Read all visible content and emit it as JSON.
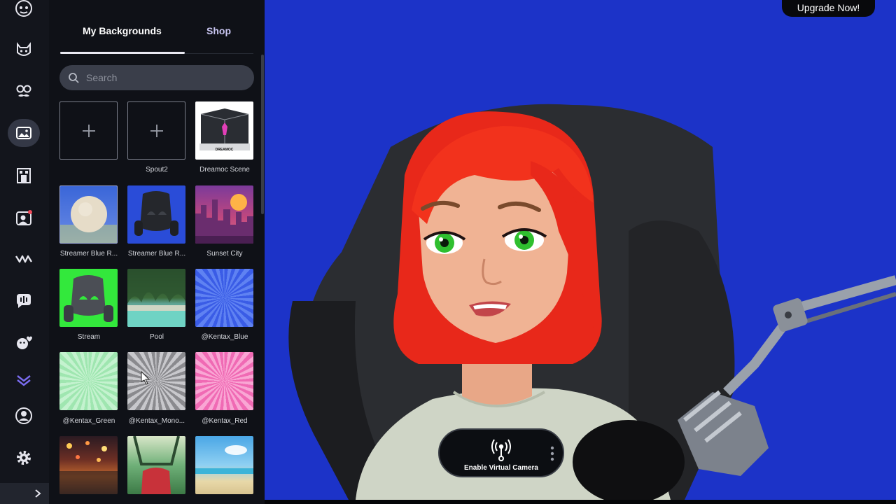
{
  "panel": {
    "tabs": {
      "mine": "My Backgrounds",
      "shop": "Shop"
    },
    "search": {
      "placeholder": "Search"
    },
    "tiles": [
      {
        "label": "",
        "type": "add"
      },
      {
        "label": "Spout2",
        "type": "add"
      },
      {
        "label": "Dreamoc Scene",
        "type": "image",
        "inner_text": "DREAMOC"
      },
      {
        "label": "Streamer Blue R...",
        "type": "image"
      },
      {
        "label": "Streamer Blue R...",
        "type": "image"
      },
      {
        "label": "Sunset City",
        "type": "image"
      },
      {
        "label": "Stream",
        "type": "image"
      },
      {
        "label": "Pool",
        "type": "image"
      },
      {
        "label": "@Kentax_Blue",
        "type": "image"
      },
      {
        "label": "@Kentax_Green",
        "type": "image"
      },
      {
        "label": "@Kentax_Mono...",
        "type": "image"
      },
      {
        "label": "@Kentax_Red",
        "type": "image"
      },
      {
        "label": "",
        "type": "image"
      },
      {
        "label": "",
        "type": "image"
      },
      {
        "label": "",
        "type": "image"
      }
    ]
  },
  "rail": {
    "icons": [
      "logo-icon",
      "cat-mask-icon",
      "glasses-mustache-icon",
      "backgrounds-icon",
      "scene-icon",
      "camera-face-icon",
      "motion-icon",
      "voice-icon",
      "emote-icon",
      "chevron-stack-icon",
      "profile-icon",
      "settings-icon",
      "expand-icon"
    ]
  },
  "preview": {
    "upgrade_label": "Upgrade Now!",
    "virtual_camera_label": "Enable Virtual Camera"
  },
  "colors": {
    "preview_bg": "#1c33c8",
    "panel_bg": "#0f1117",
    "rail_bg": "#13151c",
    "hair": "#f2321c",
    "eyes": "#2fbf2f"
  }
}
